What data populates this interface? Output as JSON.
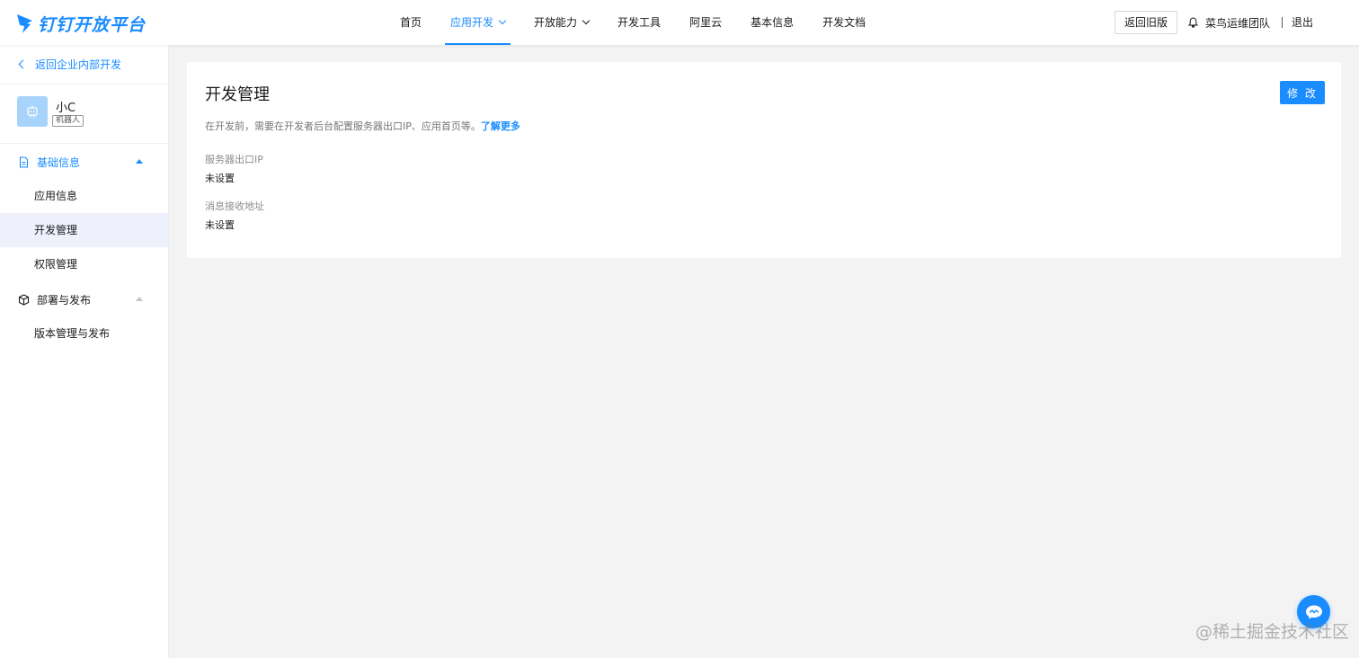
{
  "header": {
    "brand": "钉钉开放平台",
    "nav": [
      {
        "label": "首页",
        "dropdown": false,
        "active": false
      },
      {
        "label": "应用开发",
        "dropdown": true,
        "active": true
      },
      {
        "label": "开放能力",
        "dropdown": true,
        "active": false
      },
      {
        "label": "开发工具",
        "dropdown": false,
        "active": false
      },
      {
        "label": "阿里云",
        "dropdown": false,
        "active": false
      },
      {
        "label": "基本信息",
        "dropdown": false,
        "active": false
      },
      {
        "label": "开发文档",
        "dropdown": false,
        "active": false
      }
    ],
    "legacy_button": "返回旧版",
    "team_name": "菜鸟运维团队",
    "logout": "退出",
    "icons": {
      "brand": "dingtalk-logo",
      "team": "bell-icon"
    }
  },
  "sidebar": {
    "back_link": "返回企业内部开发",
    "app": {
      "name": "小C",
      "tag": "机器人",
      "icon": "robot-avatar"
    },
    "groups": [
      {
        "label": "基础信息",
        "icon": "document-icon",
        "expanded": true,
        "items": [
          {
            "label": "应用信息",
            "active": false
          },
          {
            "label": "开发管理",
            "active": true
          },
          {
            "label": "权限管理",
            "active": false
          }
        ]
      },
      {
        "label": "部署与发布",
        "icon": "cube-icon",
        "expanded": true,
        "items": [
          {
            "label": "版本管理与发布",
            "active": false
          }
        ]
      }
    ]
  },
  "main": {
    "title": "开发管理",
    "edit_button": "修 改",
    "description": "在开发前，需要在开发者后台配置服务器出口IP、应用首页等。",
    "learn_more": "了解更多",
    "fields": [
      {
        "label": "服务器出口IP",
        "value": "未设置"
      },
      {
        "label": "消息接收地址",
        "value": "未设置"
      }
    ]
  },
  "overlay": {
    "watermark": "@稀土掘金技术社区",
    "help_icon": "chat-help-icon"
  },
  "colors": {
    "accent": "#1a8cff",
    "background": "#f3f3f4",
    "active_menu_bg": "#eef0fb"
  }
}
